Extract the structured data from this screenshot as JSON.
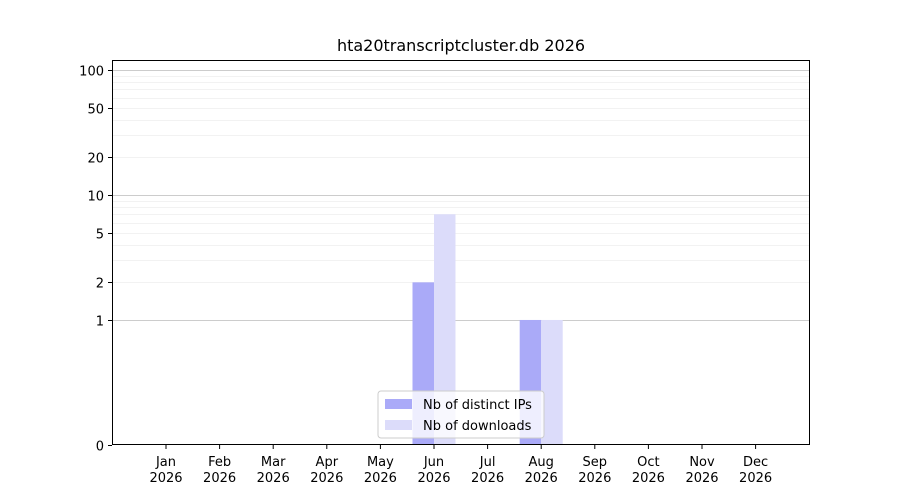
{
  "chart_data": {
    "type": "bar",
    "title": "hta20transcriptcluster.db 2026",
    "xlabel": "",
    "ylabel": "",
    "yscale": "symlog",
    "ylim": [
      0,
      120
    ],
    "yticks": [
      0,
      1,
      2,
      5,
      10,
      20,
      50,
      100
    ],
    "categories": [
      "Jan\n2026",
      "Feb\n2026",
      "Mar\n2026",
      "Apr\n2026",
      "May\n2026",
      "Jun\n2026",
      "Jul\n2026",
      "Aug\n2026",
      "Sep\n2026",
      "Oct\n2026",
      "Nov\n2026",
      "Dec\n2026"
    ],
    "series": [
      {
        "name": "Nb of distinct IPs",
        "color": "#aaaaf8",
        "values": [
          0,
          0,
          0,
          0,
          0,
          2,
          0,
          1,
          0,
          0,
          0,
          0
        ]
      },
      {
        "name": "Nb of downloads",
        "color": "#dcdcfa",
        "values": [
          0,
          0,
          0,
          0,
          0,
          7,
          0,
          1,
          0,
          0,
          0,
          0
        ]
      }
    ],
    "grid": true,
    "legend_position": "lower-center"
  }
}
